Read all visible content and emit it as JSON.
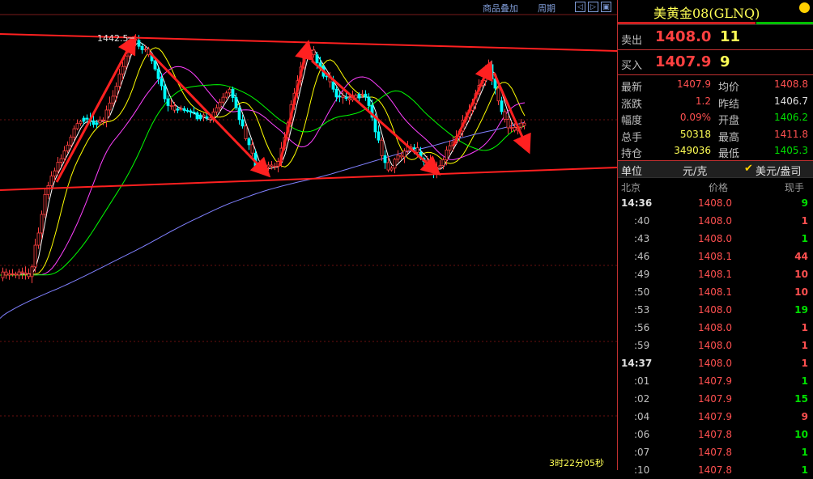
{
  "toolbar": {
    "overlay_label": "商品叠加",
    "period_label": "周期"
  },
  "chart": {
    "high_label": "1442.5",
    "timer": "3时22分05秒"
  },
  "colors": {
    "up": "#ff4040",
    "down": "#00ffff",
    "ma5": "#ffffff",
    "ma10": "#ffff00",
    "ma20": "#ff40ff",
    "ma30": "#00ff00",
    "ma60": "#8080ff",
    "trend": "#ff2020"
  },
  "quote": {
    "title": "美黄金08(GLNQ)",
    "ask_label": "卖出",
    "ask_price": "1408.0",
    "ask_vol": "11",
    "bid_label": "买入",
    "bid_price": "1407.9",
    "bid_vol": "9",
    "stats": [
      {
        "k1": "最新",
        "v1": "1407.9",
        "c1": "#ff5050",
        "k2": "均价",
        "v2": "1408.8",
        "c2": "#ff5050"
      },
      {
        "k1": "涨跌",
        "v1": "1.2",
        "c1": "#ff5050",
        "k2": "昨结",
        "v2": "1406.7",
        "c2": "#e0e0e0"
      },
      {
        "k1": "幅度",
        "v1": "0.09%",
        "c1": "#ff5050",
        "k2": "开盘",
        "v2": "1406.2",
        "c2": "#00e000"
      },
      {
        "k1": "总手",
        "v1": "50318",
        "c1": "#ffff55",
        "k2": "最高",
        "v2": "1411.8",
        "c2": "#ff5050"
      },
      {
        "k1": "持仓",
        "v1": "349036",
        "c1": "#ffff55",
        "k2": "最低",
        "v2": "1405.3",
        "c2": "#00e000"
      }
    ],
    "unit_label": "单位",
    "unit_value": "元/克",
    "unit_alt": "美元/盎司",
    "col_time": "北京",
    "col_price": "价格",
    "col_vol": "现手",
    "ticks": [
      {
        "time": "14:36",
        "full": true,
        "price": "1408.0",
        "vol": "9",
        "red": false
      },
      {
        "time": ":40",
        "full": false,
        "price": "1408.0",
        "vol": "1",
        "red": true
      },
      {
        "time": ":43",
        "full": false,
        "price": "1408.0",
        "vol": "1",
        "red": false
      },
      {
        "time": ":46",
        "full": false,
        "price": "1408.1",
        "vol": "44",
        "red": true
      },
      {
        "time": ":49",
        "full": false,
        "price": "1408.1",
        "vol": "10",
        "red": true
      },
      {
        "time": ":50",
        "full": false,
        "price": "1408.1",
        "vol": "10",
        "red": true
      },
      {
        "time": ":53",
        "full": false,
        "price": "1408.0",
        "vol": "19",
        "red": false
      },
      {
        "time": ":56",
        "full": false,
        "price": "1408.0",
        "vol": "1",
        "red": true
      },
      {
        "time": ":59",
        "full": false,
        "price": "1408.0",
        "vol": "1",
        "red": true
      },
      {
        "time": "14:37",
        "full": true,
        "price": "1408.0",
        "vol": "1",
        "red": true
      },
      {
        "time": ":01",
        "full": false,
        "price": "1407.9",
        "vol": "1",
        "red": false
      },
      {
        "time": ":02",
        "full": false,
        "price": "1407.9",
        "vol": "15",
        "red": false
      },
      {
        "time": ":04",
        "full": false,
        "price": "1407.9",
        "vol": "9",
        "red": true
      },
      {
        "time": ":06",
        "full": false,
        "price": "1407.8",
        "vol": "10",
        "red": false
      },
      {
        "time": ":07",
        "full": false,
        "price": "1407.8",
        "vol": "1",
        "red": false
      },
      {
        "time": ":10",
        "full": false,
        "price": "1407.8",
        "vol": "1",
        "red": false
      }
    ]
  }
}
